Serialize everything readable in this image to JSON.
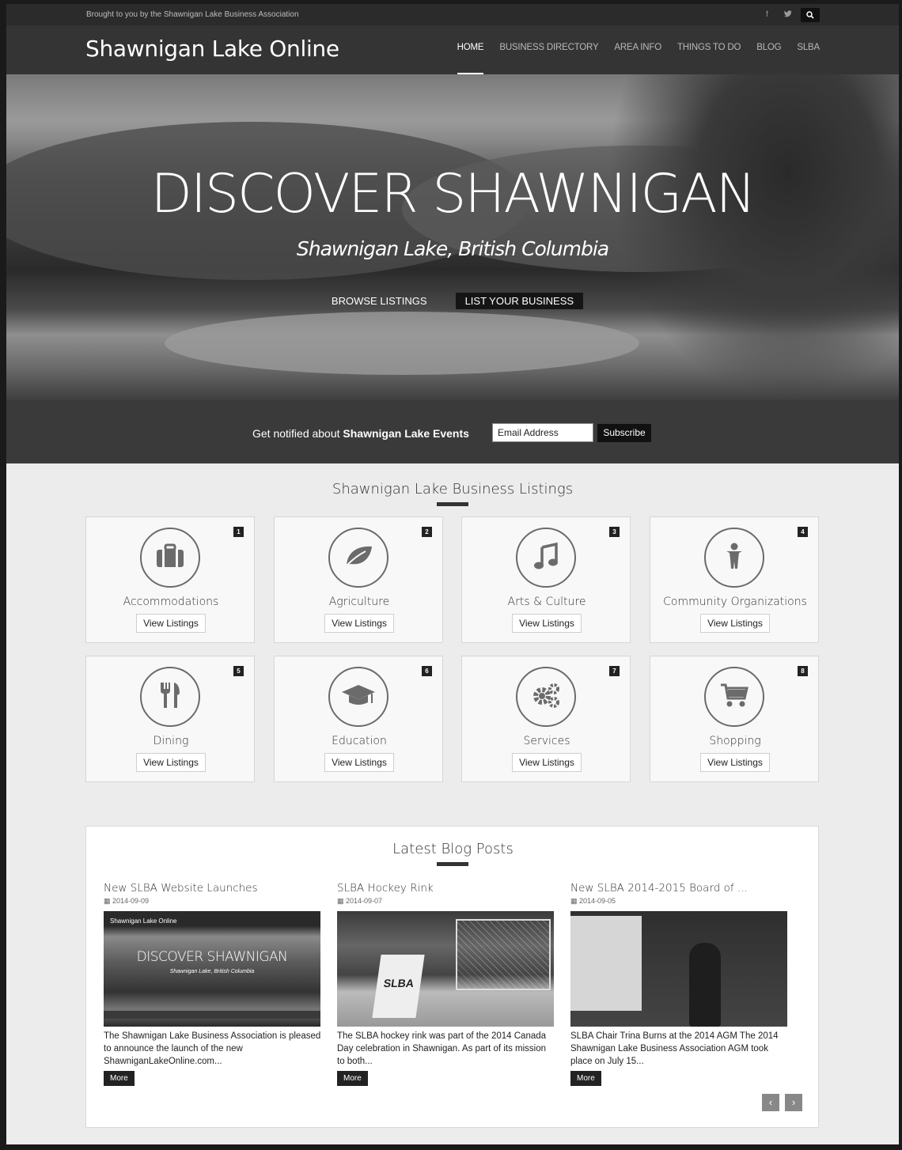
{
  "topbar": {
    "tagline": "Brought to you by the Shawnigan Lake Business Association",
    "facebook_icon": "f",
    "twitter_icon": "t",
    "search_icon": "search"
  },
  "header": {
    "brand": "Shawnigan Lake Online",
    "nav": [
      "HOME",
      "BUSINESS DIRECTORY",
      "AREA INFO",
      "THINGS TO DO",
      "BLOG",
      "SLBA"
    ]
  },
  "hero": {
    "title": "DISCOVER SHAWNIGAN",
    "subtitle": "Shawnigan Lake, British Columbia",
    "browse_label": "BROWSE LISTINGS",
    "list_label": "LIST YOUR BUSINESS"
  },
  "subscribe": {
    "text_prefix": "Get notified about ",
    "text_bold": "Shawnigan Lake Events",
    "email_placeholder": "Email Address",
    "button": "Subscribe"
  },
  "listings": {
    "title": "Shawnigan Lake Business Listings",
    "view_label": "View Listings",
    "cards": [
      {
        "num": "1",
        "label": "Accommodations",
        "icon": "suitcase-icon"
      },
      {
        "num": "2",
        "label": "Agriculture",
        "icon": "leaf-icon"
      },
      {
        "num": "3",
        "label": "Arts & Culture",
        "icon": "music-note-icon"
      },
      {
        "num": "4",
        "label": "Community Organizations",
        "icon": "person-icon"
      },
      {
        "num": "5",
        "label": "Dining",
        "icon": "cutlery-icon"
      },
      {
        "num": "6",
        "label": "Education",
        "icon": "graduation-cap-icon"
      },
      {
        "num": "7",
        "label": "Services",
        "icon": "gears-icon"
      },
      {
        "num": "8",
        "label": "Shopping",
        "icon": "cart-icon"
      }
    ]
  },
  "blog": {
    "title": "Latest Blog Posts",
    "more_label": "More",
    "posts": [
      {
        "title": "New SLBA Website Launches",
        "date": "2014-09-09",
        "excerpt": "The Shawnigan Lake Business Association is pleased to announce the launch of the new ShawniganLakeOnline.com..."
      },
      {
        "title": "SLBA Hockey Rink",
        "date": "2014-09-07",
        "excerpt": "The SLBA hockey rink was part of the 2014 Canada Day celebration in Shawnigan. As part of its mission to both..."
      },
      {
        "title": "New SLBA 2014-2015 Board of ...",
        "date": "2014-09-05",
        "excerpt": "SLBA Chair Trina Burns at the 2014 AGM The 2014 Shawnigan Lake Business Association AGM took place on July 15..."
      }
    ],
    "thumb1": {
      "brand": "Shawnigan Lake Online",
      "title": "DISCOVER SHAWNIGAN",
      "subtitle": "Shawnigan Lake, British Columbia"
    },
    "thumb2_sign": "SLBA",
    "prev_icon": "‹",
    "next_icon": "›"
  }
}
